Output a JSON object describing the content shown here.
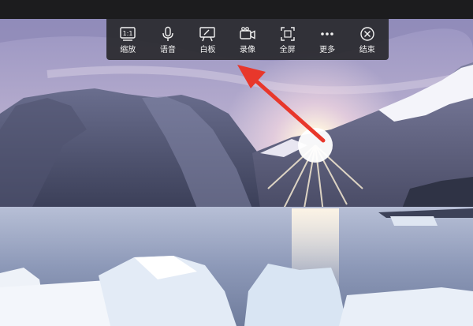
{
  "toolbar": {
    "items": [
      {
        "label": "缩放",
        "icon": "zoom-1to1-icon",
        "glyph": "1:1"
      },
      {
        "label": "语音",
        "icon": "microphone-icon"
      },
      {
        "label": "白板",
        "icon": "whiteboard-icon"
      },
      {
        "label": "录像",
        "icon": "video-camera-icon"
      },
      {
        "label": "全屏",
        "icon": "fullscreen-icon"
      },
      {
        "label": "更多",
        "icon": "more-dots-icon"
      },
      {
        "label": "结束",
        "icon": "close-circle-icon"
      }
    ]
  },
  "annotation": {
    "arrow_color": "#e8372b"
  },
  "colors": {
    "toolbar_bg": "#2a2a2e",
    "label": "#f2f2f2"
  }
}
